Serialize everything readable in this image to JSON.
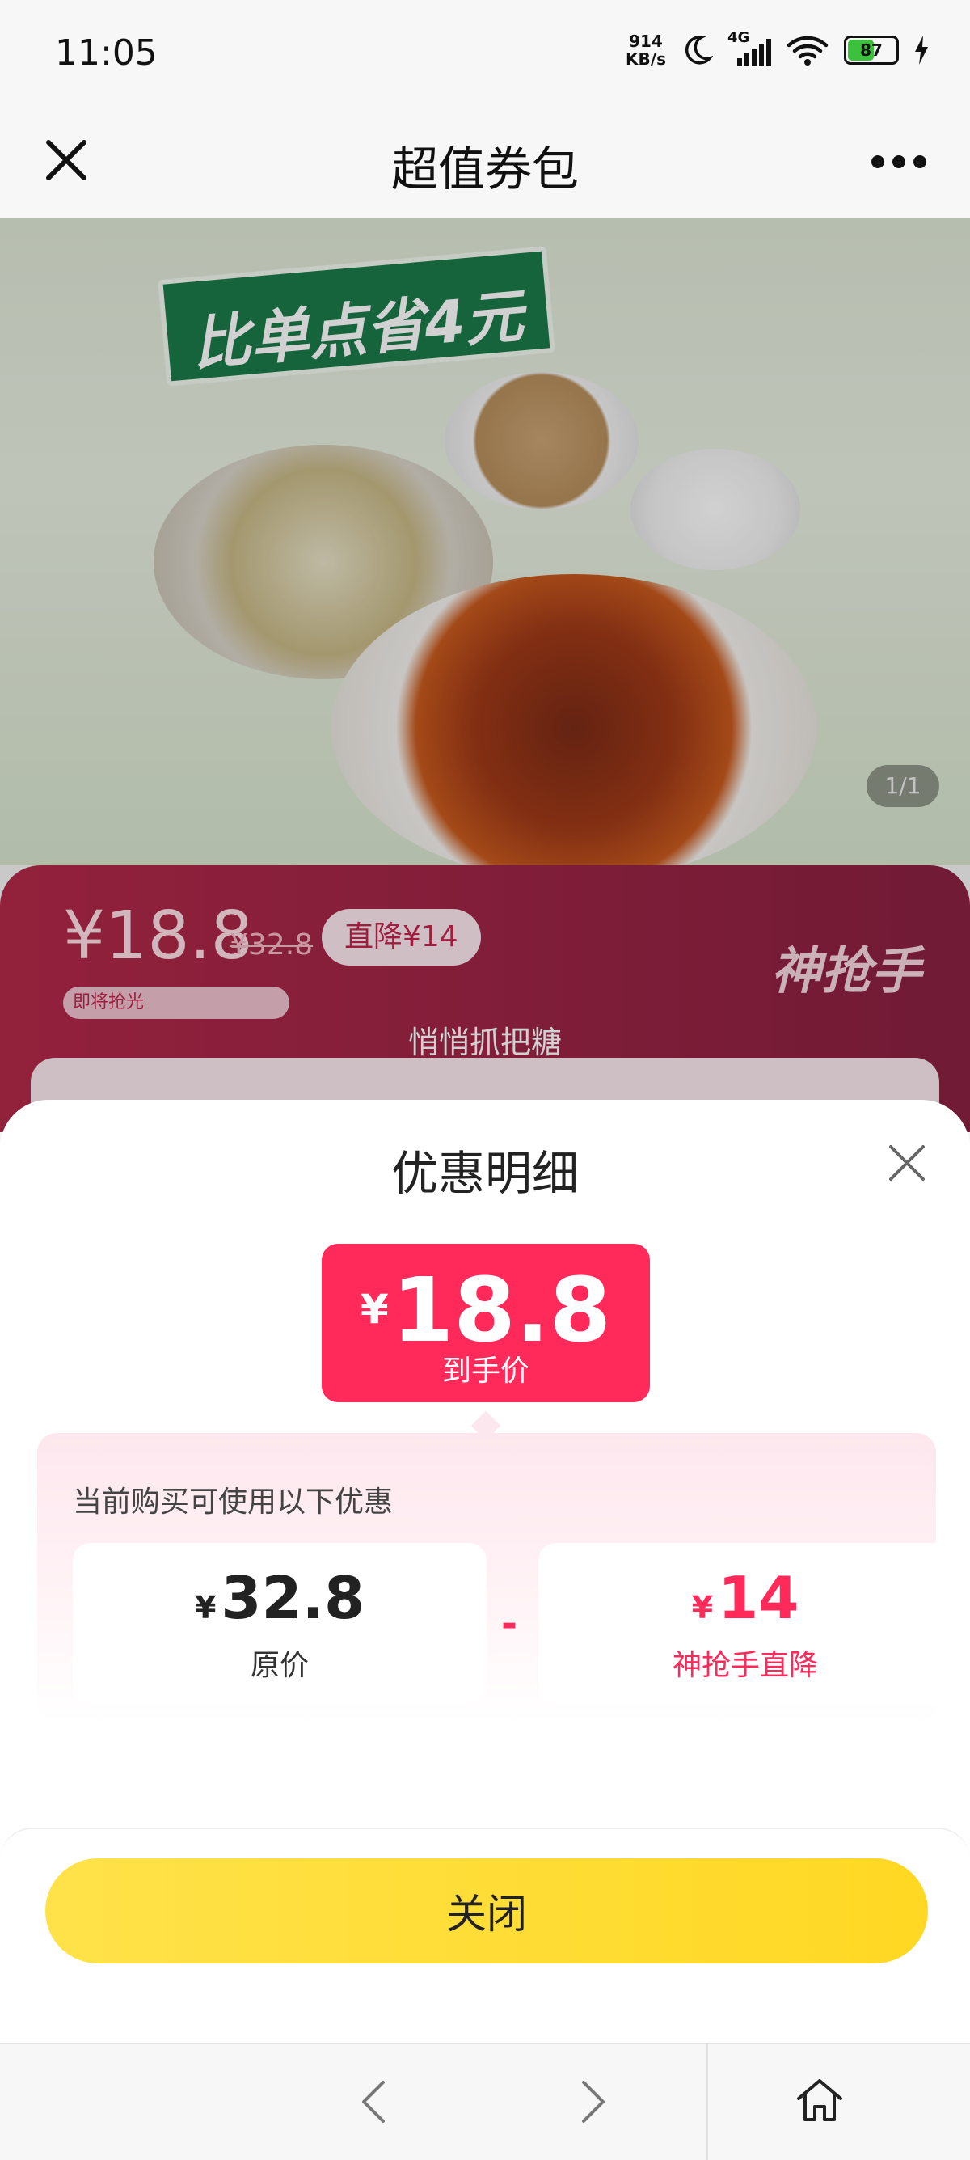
{
  "status_bar": {
    "time": "11:05",
    "net_speed_value": "914",
    "net_speed_unit": "KB/s",
    "network": "4G",
    "battery": "87",
    "icons": [
      "moon-icon",
      "signal-icon",
      "wifi-icon",
      "battery-icon",
      "charging-icon"
    ]
  },
  "nav": {
    "title": "超值券包",
    "close_icon": "close-icon",
    "more_icon": "more-icon"
  },
  "hero": {
    "save_tag": "比单点省4元",
    "pager": "1/1"
  },
  "promo": {
    "price": "¥18.8",
    "original_price": "¥32.8",
    "badge": "直降¥14",
    "progress_label": "即将抢光",
    "logo_text": "神抢手",
    "subtitle": "悄悄抓把糖"
  },
  "sheet": {
    "title": "优惠明细",
    "final_currency": "¥",
    "final_price": "18.8",
    "final_label": "到手价",
    "detail_heading": "当前购买可使用以下优惠",
    "original": {
      "currency": "¥",
      "value": "32.8",
      "label": "原价"
    },
    "operator": "-",
    "discount": {
      "currency": "¥",
      "value": "14",
      "label": "神抢手直降"
    },
    "close_button": "关闭"
  },
  "toolbar": {
    "icons": [
      "back-icon",
      "forward-icon",
      "home-icon"
    ]
  },
  "colors": {
    "accent_red": "#ff2a5a",
    "button_yellow": "#ffd823",
    "promo_bg": "#b3294a"
  }
}
